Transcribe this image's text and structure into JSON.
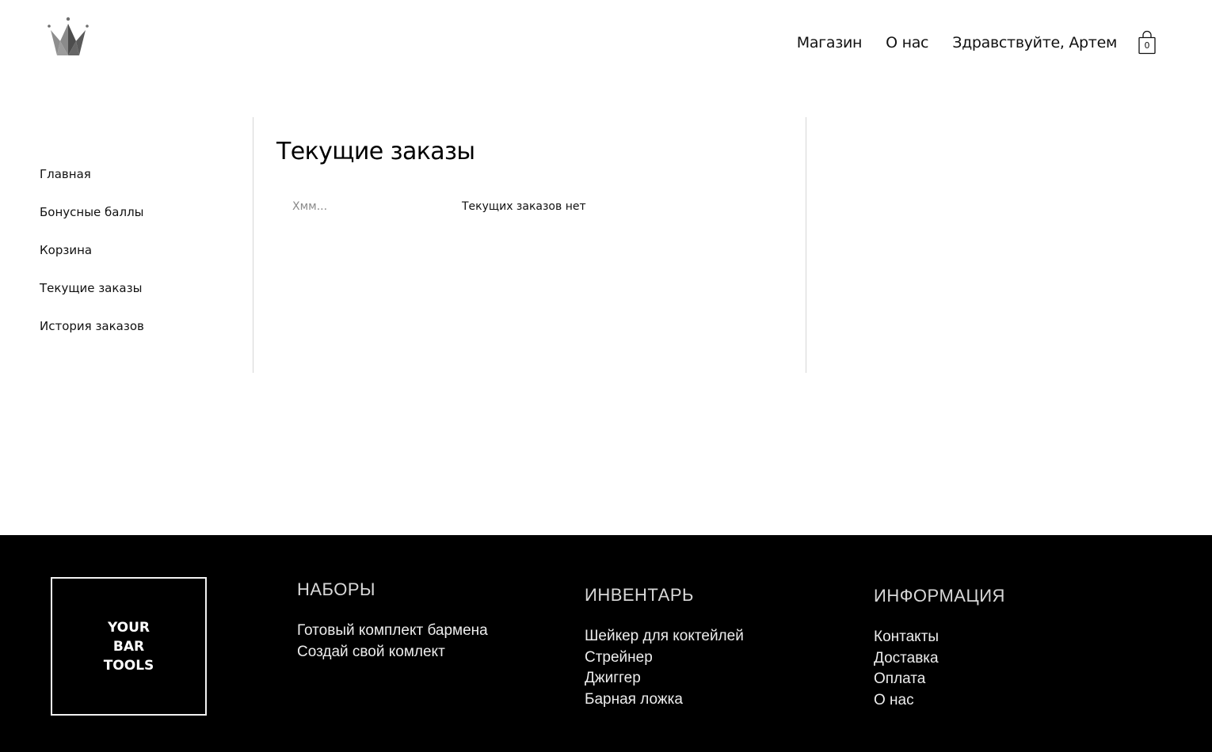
{
  "header": {
    "logo_icon": "crown-icon",
    "nav": {
      "shop": "Магазин",
      "about": "О нас",
      "greeting": "Здравствуйте, Артем"
    },
    "cart": {
      "icon": "shopping-bag-icon",
      "count": "0"
    }
  },
  "sidebar": {
    "items": [
      {
        "label": "Главная"
      },
      {
        "label": "Бонусные баллы"
      },
      {
        "label": "Корзина"
      },
      {
        "label": "Текущие заказы"
      },
      {
        "label": "История заказов"
      }
    ]
  },
  "main": {
    "title": "Текущие заказы",
    "empty_hint": "Хмм...",
    "empty_message": "Текущих заказов нет"
  },
  "footer": {
    "logo_lines": [
      "YOUR",
      "BAR",
      "TOOLS"
    ],
    "columns": [
      {
        "heading": "НАБОРЫ",
        "links": [
          "Готовый комплект бармена",
          "Создай свой комлект"
        ]
      },
      {
        "heading": "ИНВЕНТАРЬ",
        "links": [
          "Шейкер для коктейлей",
          "Стрейнер",
          "Джиггер",
          "Барная ложка"
        ]
      },
      {
        "heading": "ИНФОРМАЦИЯ",
        "links": [
          "Контакты",
          "Доставка",
          "Оплата",
          "О нас"
        ]
      }
    ]
  },
  "colors": {
    "background": "#ffffff",
    "text": "#111111",
    "muted": "#8a8a8a",
    "divider": "#d6d6d6",
    "footer_bg": "#000000",
    "logo_gray": "#6f6f6f"
  }
}
